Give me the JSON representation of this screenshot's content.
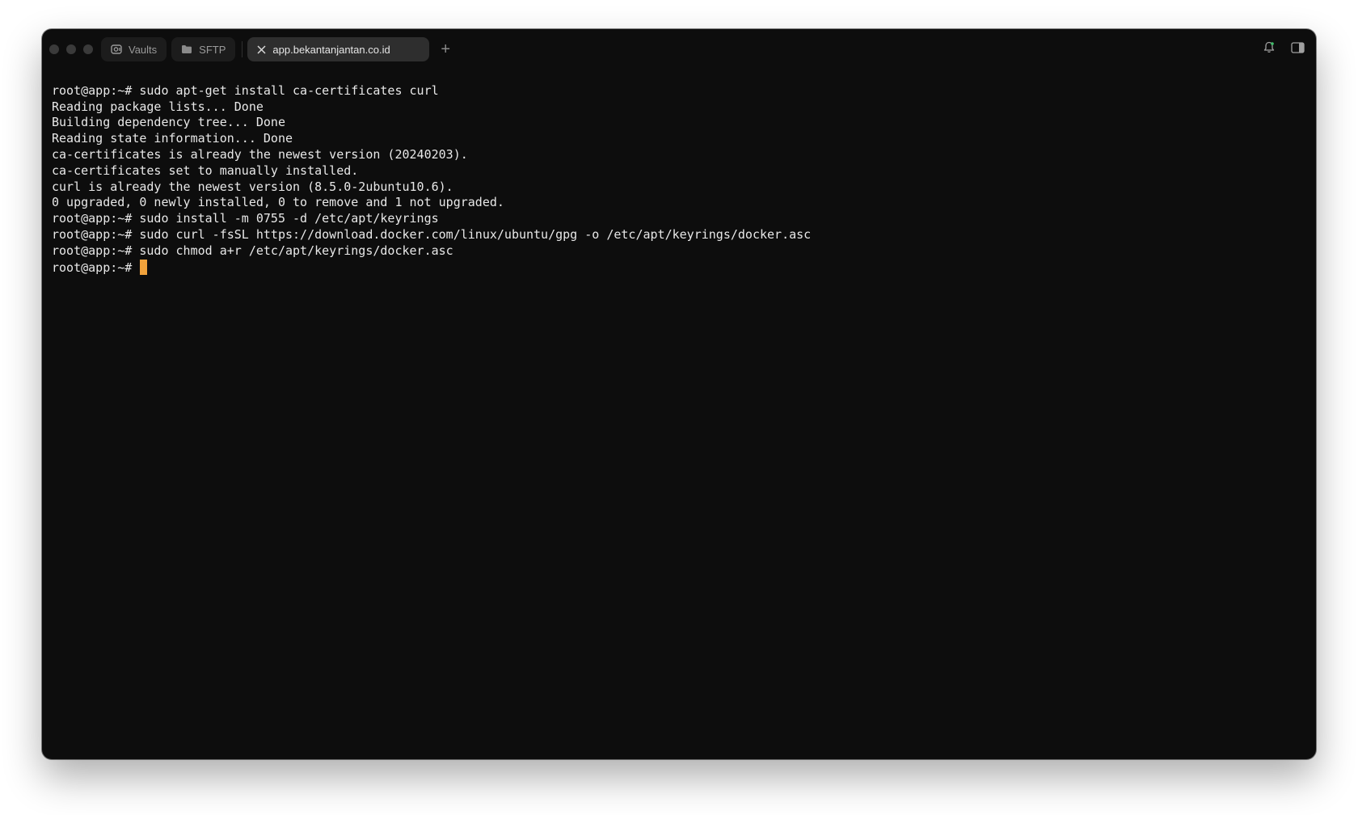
{
  "window": {
    "tabs": [
      {
        "label": "Vaults",
        "icon": "vault-icon"
      },
      {
        "label": "SFTP",
        "icon": "folder-icon"
      },
      {
        "label": "app.bekantanjantan.co.id",
        "icon": "close-icon",
        "active": true
      }
    ],
    "new_tab_label": "+",
    "right_icons": [
      "bell-icon",
      "sidebar-toggle-icon"
    ]
  },
  "terminal": {
    "lines": [
      "root@app:~# sudo apt-get install ca-certificates curl",
      "Reading package lists... Done",
      "Building dependency tree... Done",
      "Reading state information... Done",
      "ca-certificates is already the newest version (20240203).",
      "ca-certificates set to manually installed.",
      "curl is already the newest version (8.5.0-2ubuntu10.6).",
      "0 upgraded, 0 newly installed, 0 to remove and 1 not upgraded.",
      "root@app:~# sudo install -m 0755 -d /etc/apt/keyrings",
      "root@app:~# sudo curl -fsSL https://download.docker.com/linux/ubuntu/gpg -o /etc/apt/keyrings/docker.asc",
      "root@app:~# sudo chmod a+r /etc/apt/keyrings/docker.asc"
    ],
    "prompt": "root@app:~# ",
    "cursor_color": "#f0a23b"
  },
  "colors": {
    "background": "#0d0d0d",
    "text": "#e8e8e8",
    "active_tab": "#2e2e2e"
  }
}
